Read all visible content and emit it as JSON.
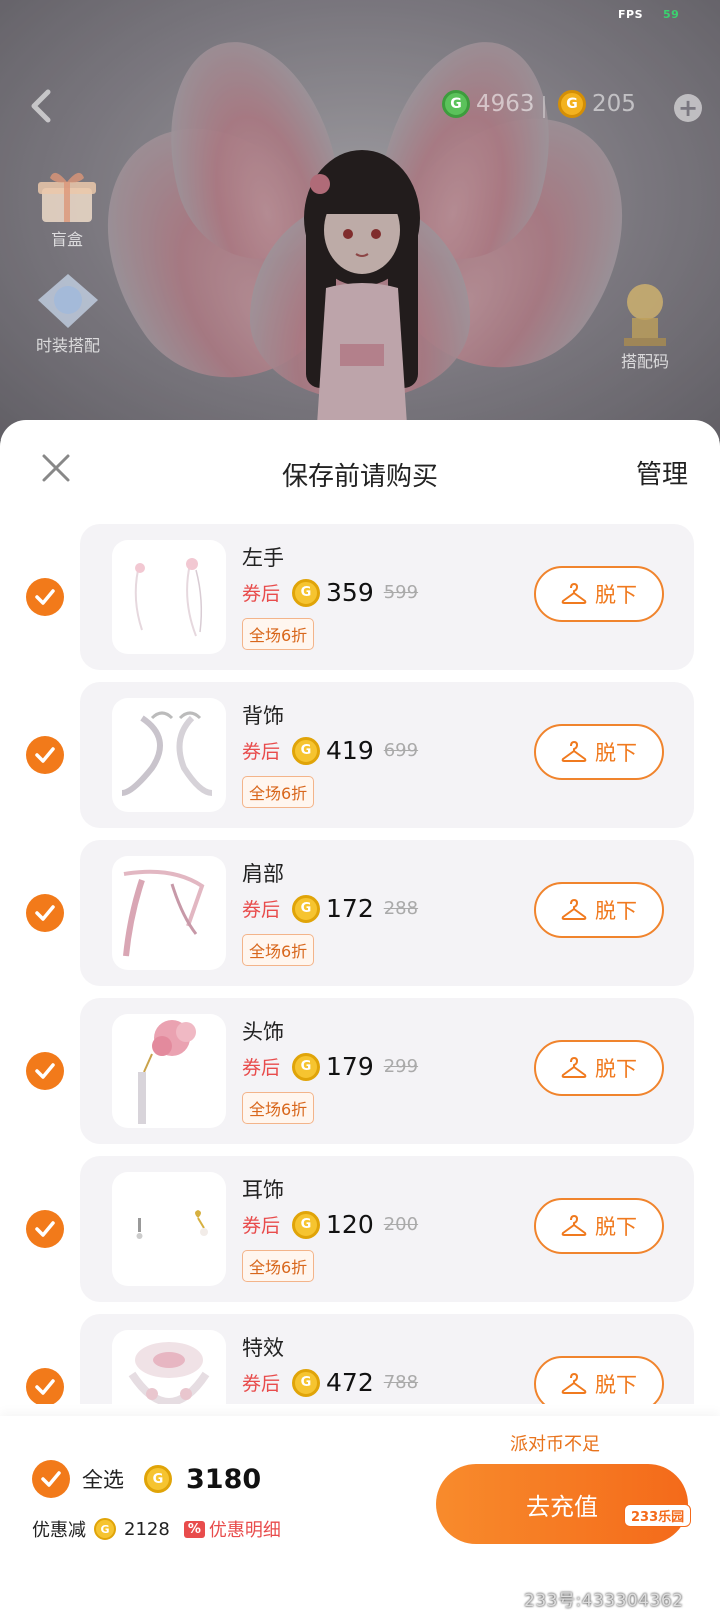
{
  "status": {
    "fps_label": "FPS",
    "fps_value": "59"
  },
  "header": {
    "currency_green": {
      "icon": "g-coin-icon",
      "value": "4963",
      "color": "#5bc25b"
    },
    "currency_gold": {
      "icon": "gold-coin-icon",
      "value": "205",
      "color": "#f3b21f"
    }
  },
  "side": {
    "blind_box_label": "盲盒",
    "item2_label": "时装搭配",
    "item3_label": "搭配码"
  },
  "sheet": {
    "title": "保存前请购买",
    "manage_label": "管理",
    "coupon_label": "券后",
    "discount_label": "全场6折",
    "takeoff_label": "脱下",
    "items": [
      {
        "name": "左手",
        "price": "359",
        "original": "599"
      },
      {
        "name": "背饰",
        "price": "419",
        "original": "699"
      },
      {
        "name": "肩部",
        "price": "172",
        "original": "288"
      },
      {
        "name": "头饰",
        "price": "179",
        "original": "299"
      },
      {
        "name": "耳饰",
        "price": "120",
        "original": "200"
      },
      {
        "name": "特效",
        "price": "472",
        "original": "788"
      }
    ]
  },
  "bottom": {
    "insufficient_text": "派对币不足",
    "select_all_label": "全选",
    "total": "3180",
    "savings_label": "优惠减",
    "savings_value": "2128",
    "discount_detail_label": "优惠明细",
    "recharge_label": "去充值",
    "accent_color": "#f27a1a"
  },
  "watermark": {
    "logo": "233乐园",
    "id": "233号:433304362"
  }
}
